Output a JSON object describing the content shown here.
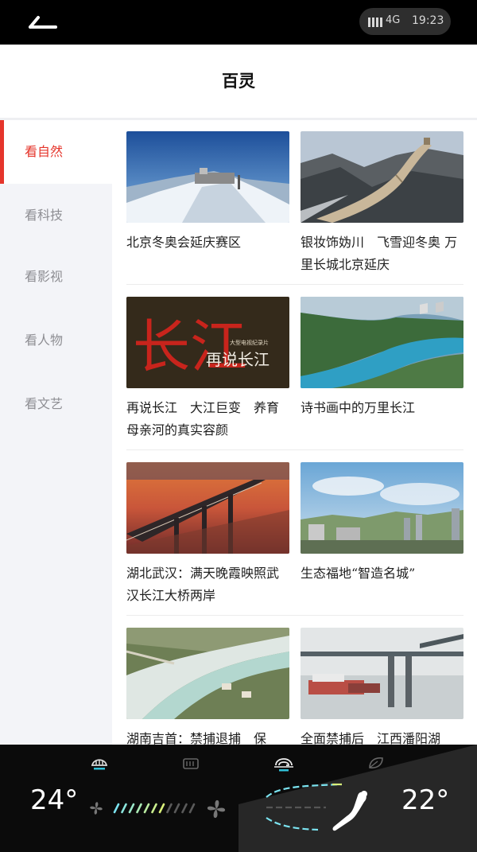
{
  "status": {
    "network": "4G",
    "time": "19:23"
  },
  "header": {
    "title": "百灵"
  },
  "sidebar": {
    "items": [
      {
        "label": "看自然",
        "active": true
      },
      {
        "label": "看科技",
        "active": false
      },
      {
        "label": "看影视",
        "active": false
      },
      {
        "label": "看人物",
        "active": false
      },
      {
        "label": "看文艺",
        "active": false
      }
    ]
  },
  "cards": [
    {
      "title": "北京冬奥会延庆赛区"
    },
    {
      "title": "银妆饰妫川　飞雪迎冬奥 万里长城北京延庆"
    },
    {
      "title": "再说长江　大江巨变　养育母亲河的真实容颜",
      "thumb_text_big": "长江",
      "thumb_text_small": "再说长江",
      "thumb_text_tiny": "大型电视纪录片"
    },
    {
      "title": "诗书画中的万里长江"
    },
    {
      "title": "湖北武汉：满天晚霞映照武汉长江大桥两岸"
    },
    {
      "title": "生态福地“智造名城”"
    },
    {
      "title": "湖南吉首：禁捕退捕　保"
    },
    {
      "title": "全面禁捕后　江西潘阳湖"
    }
  ],
  "climate": {
    "driver_temp": "24°",
    "passenger_temp": "22°",
    "fan_level": 7,
    "fan_max": 11,
    "icons": [
      "front-defrost-icon",
      "rear-defrost-icon",
      "recirculation-icon",
      "eco-leaf-icon",
      "fan-low-icon",
      "fan-high-icon",
      "seat-airflow-icon"
    ]
  },
  "colors": {
    "accent": "#e5352b",
    "fan_active": "#7be3f0",
    "fan_active_end": "#d9f07a",
    "fan_inactive": "#5a5a5a"
  }
}
